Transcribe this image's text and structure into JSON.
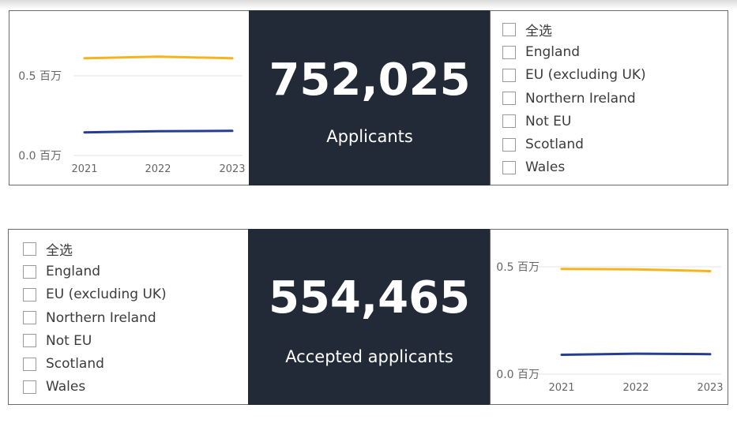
{
  "colors": {
    "card_bg": "#222a37",
    "series_a": "#f5b41e",
    "series_b": "#263e8f",
    "border": "#6b6b6b"
  },
  "slicer": {
    "items": [
      "全选",
      "England",
      "EU (excluding UK)",
      "Northern Ireland",
      "Not EU",
      "Scotland",
      "Wales"
    ]
  },
  "applicants": {
    "value": "752,025",
    "label": "Applicants"
  },
  "accepted": {
    "value": "554,465",
    "label": "Accepted applicants"
  },
  "chart_data": [
    {
      "type": "line",
      "x": [
        "2021",
        "2022",
        "2023"
      ],
      "y_ticks": [
        "0.0 百万",
        "0.5 百万"
      ],
      "ylim": [
        0,
        0.5
      ],
      "series": [
        {
          "color": "#f5b41e",
          "values": [
            0.61,
            0.62,
            0.61
          ]
        },
        {
          "color": "#263e8f",
          "values": [
            0.145,
            0.152,
            0.155
          ]
        }
      ],
      "grid": true
    },
    {
      "type": "line",
      "x": [
        "2021",
        "2022",
        "2023"
      ],
      "y_ticks": [
        "0.0 百万",
        "0.5 百万"
      ],
      "ylim": [
        0,
        0.5
      ],
      "series": [
        {
          "color": "#f5b41e",
          "values": [
            0.49,
            0.488,
            0.48
          ]
        },
        {
          "color": "#263e8f",
          "values": [
            0.09,
            0.095,
            0.093
          ]
        }
      ],
      "grid": true
    }
  ]
}
